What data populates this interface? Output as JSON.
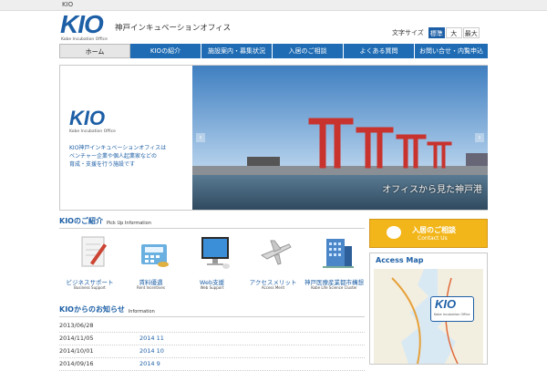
{
  "topbar": {
    "label": "KIO"
  },
  "header": {
    "logo_big": "KIO",
    "logo_small": "Kobe Incubation Office",
    "site_name": "神戸インキュベーションオフィス",
    "font_size_label": "文字サイズ",
    "font_sizes": [
      "標準",
      "大",
      "最大"
    ],
    "font_size_selected": "標準"
  },
  "nav": {
    "items": [
      "ホーム",
      "KIOの紹介",
      "施設案内・募集状況",
      "入居のご相談",
      "よくある質問",
      "お問い合せ・内覧申込"
    ]
  },
  "hero": {
    "logo_big": "KIO",
    "logo_small": "Kobe Incubation Office",
    "desc_lines": [
      "KIO神戸インキュベーションオフィスは",
      "ベンチャー企業や個人起業家などの",
      "育成・支援を行う施設です"
    ],
    "caption": "オフィスから見た神戸港",
    "prev": "‹",
    "next": "›"
  },
  "pickup": {
    "title": "KIOのご紹介",
    "subtitle": "Pick Up Information",
    "items": [
      {
        "label": "ビジネスサポート",
        "en": "Business Support",
        "icon": "document-pen-icon"
      },
      {
        "label": "賃料優遇",
        "en": "Rent Incentives",
        "icon": "calculator-icon"
      },
      {
        "label": "Web支援",
        "en": "Web Support",
        "icon": "monitor-icon"
      },
      {
        "label": "アクセスメリット",
        "en": "Access Merit",
        "icon": "airplane-icon"
      },
      {
        "label": "神戸医療産業都市構想",
        "en": "Kobe Life Science Cluster",
        "icon": "building-icon"
      }
    ]
  },
  "news": {
    "title": "KIOからのお知らせ",
    "subtitle": "Information",
    "rows": [
      {
        "date": "2013/06/28",
        "title": ""
      },
      {
        "date": "2014/11/05",
        "title": "2014 11"
      },
      {
        "date": "2014/10/01",
        "title": "2014 10"
      },
      {
        "date": "2014/09/16",
        "title": "2014 9"
      }
    ]
  },
  "sidebar": {
    "cta_label": "入居のご相談",
    "cta_sub": "Contact Us",
    "access_title": "Access Map",
    "map_logo": "KIO",
    "map_logo_small": "Kobe Incubation Office"
  },
  "colors": {
    "brand": "#1d5fa6",
    "nav": "#1f6cb4",
    "cta": "#f2b61a"
  }
}
